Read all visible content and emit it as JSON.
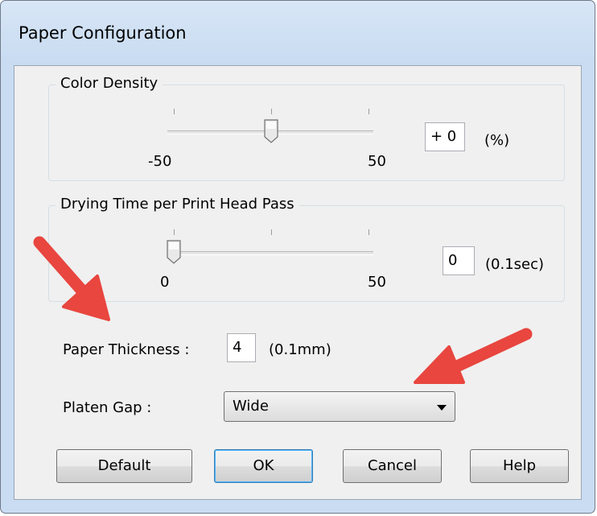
{
  "window": {
    "title": "Paper Configuration"
  },
  "color_density": {
    "legend": "Color Density",
    "min_label": "-50",
    "max_label": "50",
    "value_text": "+ 0",
    "unit": "(%)",
    "slider_value": 0,
    "slider_min": -50,
    "slider_max": 50
  },
  "drying_time": {
    "legend": "Drying Time per Print Head Pass",
    "min_label": "0",
    "max_label": "50",
    "value_text": "0",
    "unit": "(0.1sec)",
    "slider_value": 0,
    "slider_min": 0,
    "slider_max": 50
  },
  "paper_thickness": {
    "label": "Paper Thickness :",
    "value": "4",
    "unit": "(0.1mm)"
  },
  "platen_gap": {
    "label": "Platen Gap :",
    "selected": "Wide"
  },
  "buttons": {
    "default": "Default",
    "ok": "OK",
    "cancel": "Cancel",
    "help": "Help"
  },
  "colors": {
    "arrow": "#e8463f",
    "window_frame": "#c9dcf2",
    "dialog_face": "#f0f0f0"
  },
  "icons": [
    "slider-thumb-icon",
    "dropdown-arrow-icon",
    "callout-arrow-icon"
  ]
}
